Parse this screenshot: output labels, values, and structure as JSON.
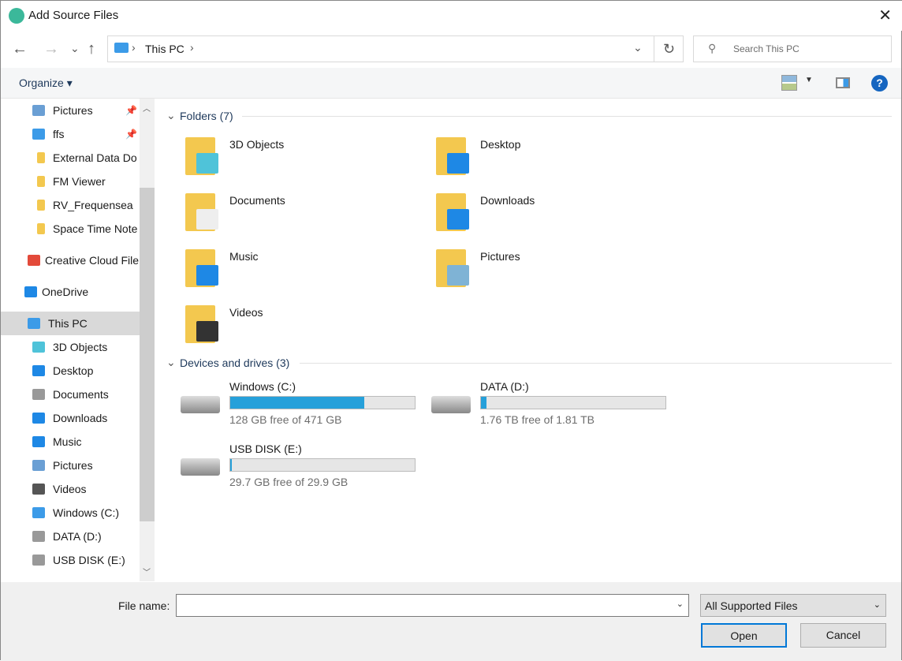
{
  "window": {
    "title": "Add Source Files",
    "close": "✕"
  },
  "nav": {
    "back": "←",
    "forward": "→",
    "recent": "⌄",
    "up": "↑"
  },
  "address": {
    "sep": "›",
    "location": "This PC",
    "dropdown": "⌄",
    "refresh": "↻"
  },
  "search": {
    "placeholder": "Search This PC",
    "icon": "⚲"
  },
  "toolbar": {
    "organize": "Organize ▾",
    "help": "?",
    "view_dd": "▼"
  },
  "sidebar": {
    "items": [
      {
        "label": "Pictures",
        "pinned": true,
        "color": "#6a9fd4"
      },
      {
        "label": "ffs",
        "pinned": true,
        "color": "#3c9be8"
      },
      {
        "label": "External Data Do",
        "color": "#f3c84f"
      },
      {
        "label": "FM Viewer",
        "color": "#f3c84f"
      },
      {
        "label": "RV_Frequensea",
        "color": "#f3c84f"
      },
      {
        "label": "Space Time Note",
        "color": "#f3c84f"
      },
      {
        "label": "Creative Cloud File",
        "color": "#e34a3a"
      },
      {
        "label": "OneDrive",
        "color": "#1e88e5"
      },
      {
        "label": "This PC",
        "selected": true,
        "color": "#3c9be8"
      },
      {
        "label": "3D Objects",
        "color": "#4fc3d9"
      },
      {
        "label": "Desktop",
        "color": "#1e88e5"
      },
      {
        "label": "Documents",
        "color": "#999999"
      },
      {
        "label": "Downloads",
        "color": "#1e88e5"
      },
      {
        "label": "Music",
        "color": "#1e88e5"
      },
      {
        "label": "Pictures",
        "color": "#6a9fd4"
      },
      {
        "label": "Videos",
        "color": "#555555"
      },
      {
        "label": "Windows (C:)",
        "color": "#3c9be8"
      },
      {
        "label": "DATA (D:)",
        "color": "#999999"
      },
      {
        "label": "USB DISK (E:)",
        "color": "#999999"
      }
    ],
    "pin": "📌",
    "scroll_up": "︿",
    "scroll_down": "﹀"
  },
  "folders": {
    "header": "Folders (7)",
    "chevron": "⌄",
    "items": [
      {
        "name": "3D Objects",
        "overlay": "#4fc3d9"
      },
      {
        "name": "Desktop",
        "overlay": "#1e88e5"
      },
      {
        "name": "Documents",
        "overlay": "#eeeeee"
      },
      {
        "name": "Downloads",
        "overlay": "#1e88e5"
      },
      {
        "name": "Music",
        "overlay": "#1e88e5"
      },
      {
        "name": "Pictures",
        "overlay": "#7fb3d5"
      },
      {
        "name": "Videos",
        "overlay": "#333333"
      }
    ]
  },
  "drives": {
    "header": "Devices and drives (3)",
    "items": [
      {
        "name": "Windows (C:)",
        "free": "128 GB free of 471 GB",
        "used_percent": 72.8
      },
      {
        "name": "DATA (D:)",
        "free": "1.76 TB free of 1.81 TB",
        "used_percent": 2.8
      },
      {
        "name": "USB DISK (E:)",
        "free": "29.7 GB free of 29.9 GB",
        "used_percent": 0.7
      }
    ]
  },
  "bottom": {
    "file_name_label": "File name:",
    "file_name_value": "",
    "filter": "All Supported Files",
    "open": "Open",
    "cancel": "Cancel",
    "dd": "⌄"
  }
}
